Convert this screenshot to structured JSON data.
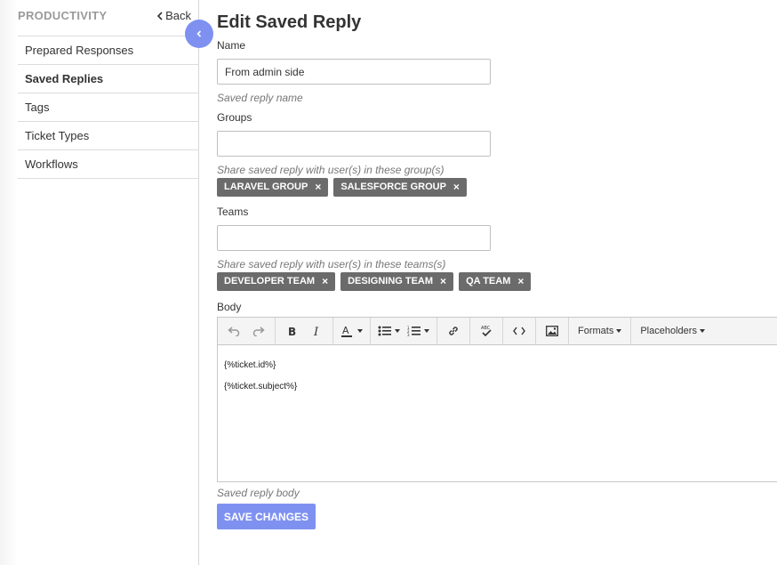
{
  "sidebar": {
    "title": "PRODUCTIVITY",
    "back_label": "Back",
    "items": [
      {
        "label": "Prepared Responses"
      },
      {
        "label": "Saved Replies"
      },
      {
        "label": "Tags"
      },
      {
        "label": "Ticket Types"
      },
      {
        "label": "Workflows"
      }
    ],
    "active_item": "Saved Replies"
  },
  "page": {
    "title": "Edit Saved Reply"
  },
  "form": {
    "name": {
      "label": "Name",
      "value": "From admin side",
      "hint": "Saved reply name"
    },
    "groups": {
      "label": "Groups",
      "value": "",
      "hint": "Share saved reply with user(s) in these group(s)",
      "tags": [
        "LARAVEL GROUP",
        "SALESFORCE GROUP"
      ]
    },
    "teams": {
      "label": "Teams",
      "value": "",
      "hint": "Share saved reply with user(s) in these teams(s)",
      "tags": [
        "DEVELOPER TEAM",
        "DESIGNING TEAM",
        "QA TEAM"
      ]
    },
    "body": {
      "label": "Body",
      "hint": "Saved reply body",
      "lines": [
        "{%ticket.id%}",
        "{%ticket.subject%}"
      ],
      "toolbar": {
        "formats_label": "Formats",
        "placeholders_label": "Placeholders",
        "icons": [
          "undo-icon",
          "redo-icon",
          "bold-icon",
          "italic-icon",
          "text-color-icon",
          "bullet-list-icon",
          "numbered-list-icon",
          "link-icon",
          "spellcheck-icon",
          "code-icon",
          "image-icon"
        ]
      }
    },
    "save_label": "SAVE CHANGES",
    "tag_remove_glyph": "×"
  },
  "colors": {
    "accent": "#7e91f1",
    "tag_bg": "#6b6b6b",
    "sidebar_title": "#9a9a9a"
  }
}
